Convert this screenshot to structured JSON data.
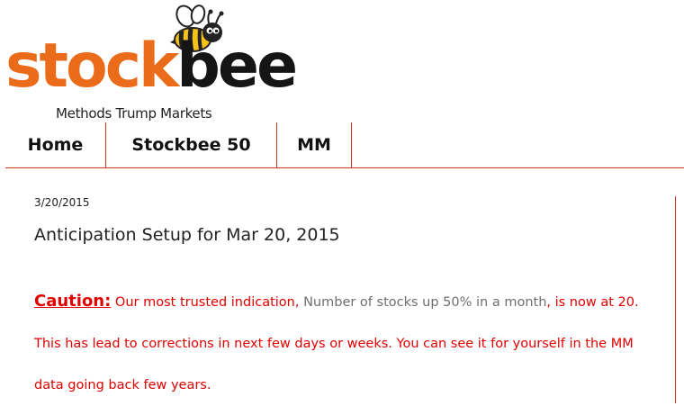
{
  "brand": {
    "name_part1": "stock",
    "name_part2": "bee",
    "tagline": "Methods Trump Markets",
    "colors": {
      "orange": "#ea6b19",
      "dark": "#151515",
      "accent_rule": "#cc3322"
    }
  },
  "nav": {
    "items": [
      {
        "label": "Home"
      },
      {
        "label": "Stockbee 50"
      },
      {
        "label": "MM"
      }
    ]
  },
  "post": {
    "date": "3/20/2015",
    "title": "Anticipation Setup for Mar 20, 2015",
    "caution_label": "Caution:",
    "body_part1": " Our most trusted indication, ",
    "body_gray": "Number of stocks up 50% in a month",
    "body_part2": ", is now at 20. This has lead to corrections in next few days or weeks. You can see it for yourself in the MM data going back few years.",
    "colors": {
      "body_text": "#e00000",
      "indicator_text": "#6f6f6f"
    }
  }
}
